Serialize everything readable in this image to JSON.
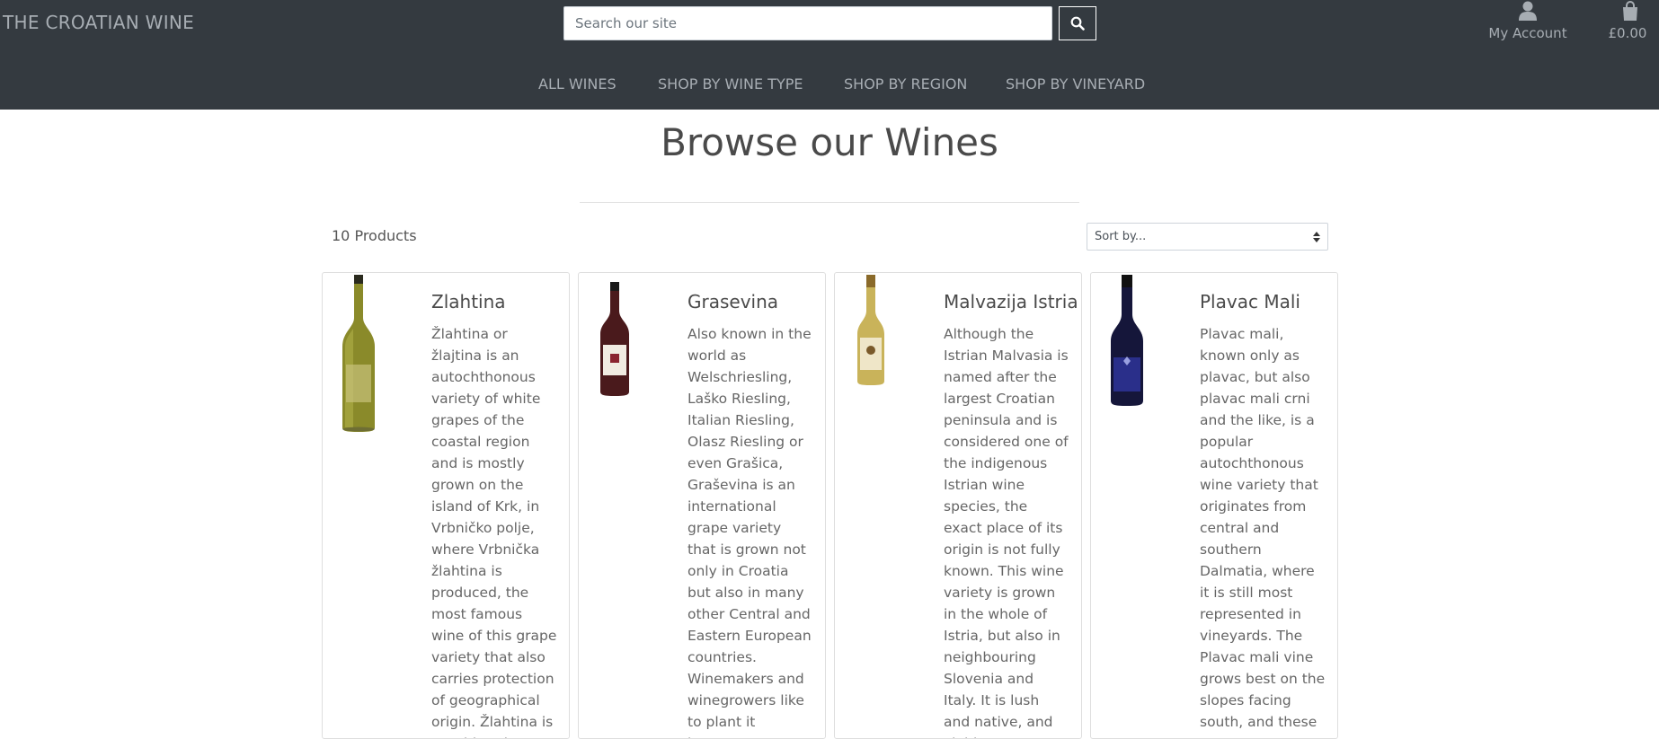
{
  "header": {
    "brand": "THE CROATIAN WINE",
    "search_placeholder": "Search our site",
    "account_label": "My Account",
    "cart_total": "£0.00"
  },
  "nav": {
    "items": [
      {
        "label": "ALL WINES"
      },
      {
        "label": "SHOP BY WINE TYPE"
      },
      {
        "label": "SHOP BY REGION"
      },
      {
        "label": "SHOP BY VINEYARD"
      }
    ]
  },
  "main": {
    "title": "Browse our Wines",
    "product_count": "10 Products",
    "sort_label": "Sort by..."
  },
  "products": [
    {
      "name": "Zlahtina",
      "description": "Žlahtina or žlajtina is an autochthonous variety of white grapes of the coastal region and is mostly grown on the island of Krk, in Vrbničko polje, where Vrbnička žlahtina is produced, the most famous wine of this grape variety that also carries protection of geographical origin. Žlahtina is considered a",
      "bottle": "white-wine-bottle"
    },
    {
      "name": "Grasevina",
      "description": "Also known in the world as Welschriesling, Laško Riesling, Italian Riesling, Olasz Riesling or even Grašica, Graševina is an international grape variety that is grown not only in Croatia but also in many other Central and Eastern European countries. Winemakers and winegrowers like to plant it because",
      "bottle": "red-wine-bottle"
    },
    {
      "name": "Malvazija Istria",
      "description": "Although the Istrian Malvasia is named after the largest Croatian peninsula and is considered one of the indigenous Istrian wine species, the exact place of its origin is not fully known. This wine variety is grown in the whole of Istria, but also in neighbouring Slovenia and Italy. It is lush and native, and yields",
      "bottle": "golden-wine-bottle"
    },
    {
      "name": "Plavac Mali",
      "description": "Plavac mali, known only as plavac, but also plavac mali crni and the like, is a popular autochthonous wine variety that originates from central and southern Dalmatia, where it is still most represented in vineyards. The Plavac mali vine grows best on the slopes facing south, and these",
      "bottle": "blue-wine-bottle"
    }
  ]
}
